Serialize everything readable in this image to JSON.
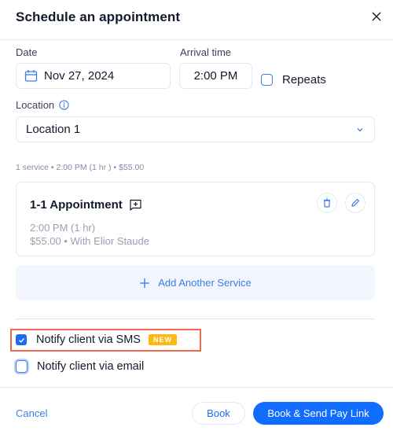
{
  "dialog": {
    "title": "Schedule an appointment",
    "close_icon": "close-icon"
  },
  "form": {
    "date_label": "Date",
    "date_value": "Nov 27, 2024",
    "arrival_label": "Arrival time",
    "arrival_value": "2:00 PM",
    "repeats_label": "Repeats",
    "repeats_checked": false,
    "location_label": "Location",
    "location_value": "Location 1"
  },
  "summary": "1 service • 2:00 PM (1 hr ) • $55.00",
  "service": {
    "name": "1-1 Appointment",
    "time": "2:00 PM  (1 hr)",
    "details": "$55.00 • With Elior Staude"
  },
  "add_service_label": "Add Another Service",
  "notifications": {
    "sms_label": "Notify client via SMS",
    "sms_checked": true,
    "sms_badge": "NEW",
    "email_label": "Notify client via email",
    "email_checked": false
  },
  "footer": {
    "cancel_label": "Cancel",
    "book_label": "Book",
    "book_send_label": "Book & Send Pay Link"
  },
  "colors": {
    "accent": "#116dff",
    "badge": "#fdb812",
    "highlight": "#f0694e"
  }
}
